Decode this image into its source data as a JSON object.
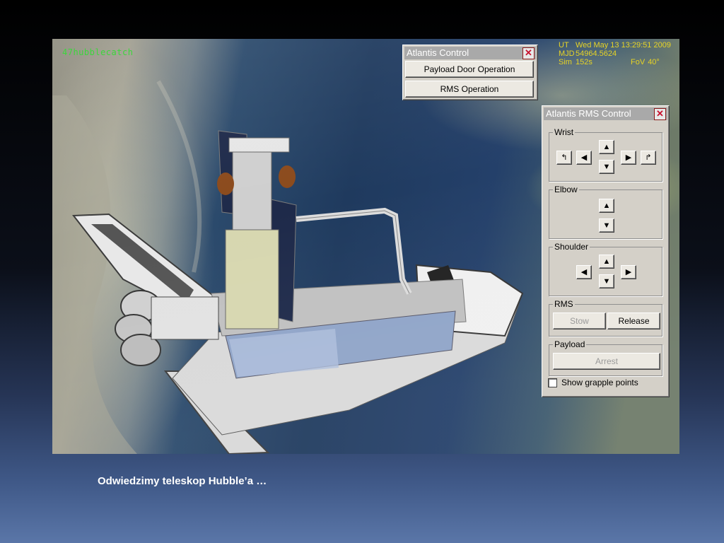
{
  "hud": {
    "scenario": "47hubblecatch",
    "ut_label": "UT",
    "ut_value": "Wed May 13 13:29:51 2009",
    "mjd_label": "MJD",
    "mjd_value": "54964.5624",
    "sim_label": "Sim",
    "sim_value": "152s",
    "fov_label": "FoV",
    "fov_value": "40°"
  },
  "atlantis_control": {
    "title": "Atlantis Control",
    "payload_door_button": "Payload Door Operation",
    "rms_operation_button": "RMS Operation"
  },
  "rms_control": {
    "title": "Atlantis RMS Control",
    "wrist_label": "Wrist",
    "elbow_label": "Elbow",
    "shoulder_label": "Shoulder",
    "rms_label": "RMS",
    "stow_button": "Stow",
    "release_button": "Release",
    "payload_label": "Payload",
    "arrest_button": "Arrest",
    "grapple_checkbox_label": "Show grapple points",
    "grapple_checked": false
  },
  "icons": {
    "close": "close-icon",
    "up": "arrow-up-icon",
    "down": "arrow-down-icon",
    "left": "arrow-left-icon",
    "right": "arrow-right-icon",
    "roll_left": "roll-left-icon",
    "roll_right": "roll-right-icon"
  },
  "caption": "Odwiedzimy teleskop Hubble’a …"
}
